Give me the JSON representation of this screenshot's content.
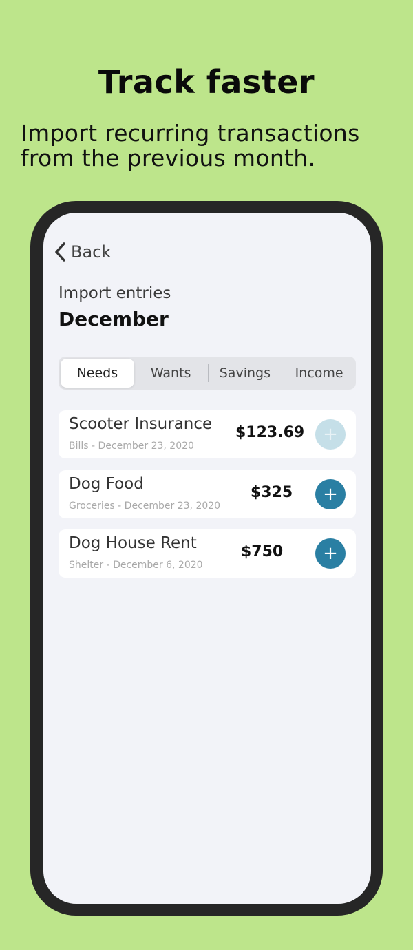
{
  "promo": {
    "headline": "Track faster",
    "subline_1": "Import recurring transactions",
    "subline_2": "from the previous month."
  },
  "nav": {
    "back_label": "Back"
  },
  "header": {
    "import_label": "Import entries",
    "month": "December"
  },
  "tabs": [
    {
      "label": "Needs",
      "active": true
    },
    {
      "label": "Wants",
      "active": false
    },
    {
      "label": "Savings",
      "active": false
    },
    {
      "label": "Income",
      "active": false
    }
  ],
  "entries": [
    {
      "name": "Scooter Insurance",
      "meta": "Bills - December 23, 2020",
      "amount": "$123.69",
      "add_icon": "+",
      "added": true
    },
    {
      "name": "Dog Food",
      "meta": "Groceries - December 23, 2020",
      "amount": "$325",
      "add_icon": "+",
      "added": false
    },
    {
      "name": "Dog House Rent",
      "meta": "Shelter - December 6, 2020",
      "amount": "$750",
      "add_icon": "+",
      "added": false
    }
  ],
  "colors": {
    "background": "#bde58b",
    "accent": "#2a7fa3",
    "accent_disabled": "#c5dfe8"
  }
}
